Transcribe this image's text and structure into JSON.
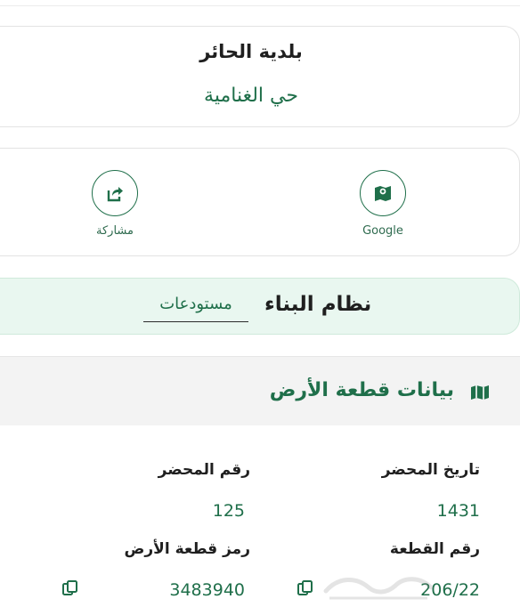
{
  "location": {
    "municipality": "بلدية الحائر",
    "district": "حي الغنامية"
  },
  "actions": {
    "google_label": "Google",
    "share_label": "مشاركة"
  },
  "building": {
    "label": "نظام البناء",
    "value": "مستودعات"
  },
  "land": {
    "title": "بيانات قطعة الأرض",
    "record_date_label": "تاريخ المحضر",
    "record_date_value": "1431",
    "record_number_label": "رقم المحضر",
    "record_number_value": "125",
    "piece_number_label": "رقم القطعة",
    "piece_number_value": "206/22",
    "land_code_label": "رمز قطعة الأرض",
    "land_code_value": "3483940"
  },
  "colors": {
    "accent": "#1f6f4a",
    "soft_green": "#e9f7f0"
  },
  "icons": [
    "map-icon",
    "share-icon",
    "copy-icon"
  ]
}
